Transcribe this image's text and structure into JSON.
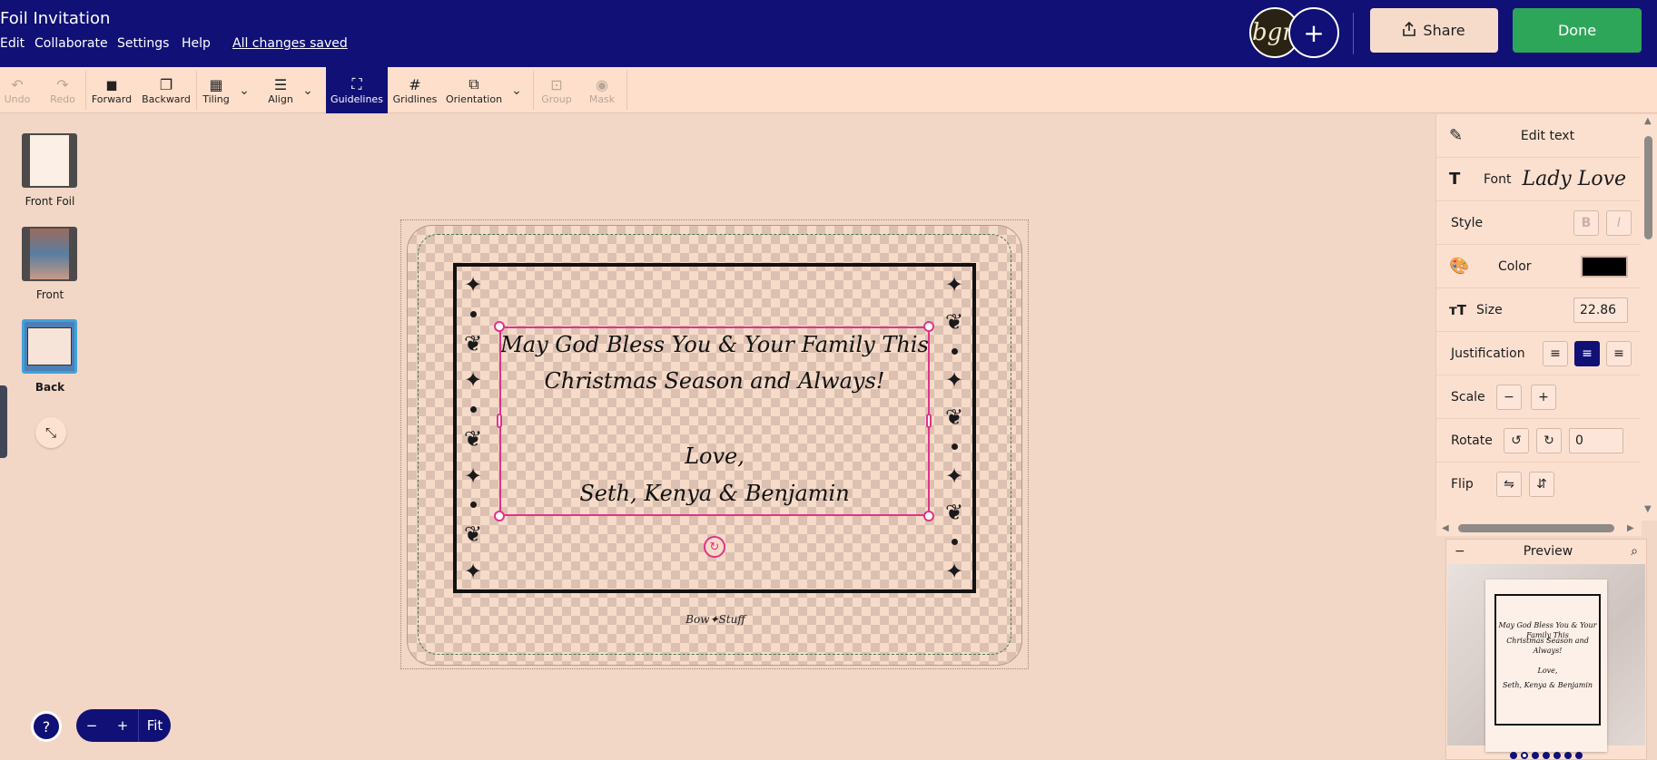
{
  "header": {
    "title": "Foil Invitation",
    "menu": [
      "Edit",
      "Collaborate",
      "Settings",
      "Help"
    ],
    "save_status": "All changes saved",
    "avatar_initials": "bgn",
    "add_collaborator": "+",
    "share_label": "Share",
    "done_label": "Done"
  },
  "toolbar": {
    "undo": "Undo",
    "redo": "Redo",
    "forward": "Forward",
    "backward": "Backward",
    "tiling": "Tiling",
    "align": "Align",
    "guidelines": "Guidelines",
    "gridlines": "Gridlines",
    "orientation": "Orientation",
    "group": "Group",
    "mask": "Mask"
  },
  "pages": {
    "front_foil": "Front Foil",
    "front": "Front",
    "back": "Back",
    "active": "Back"
  },
  "canvas": {
    "line1": "May God Bless You & Your Family This",
    "line2": "Christmas Season and Always!",
    "line3": "Love,",
    "line4": "Seth, Kenya & Benjamin",
    "brand": "Bow✦Stuff"
  },
  "zoom": {
    "help": "?",
    "minus": "−",
    "plus": "+",
    "fit": "Fit"
  },
  "properties": {
    "edit_text": "Edit text",
    "font_label": "Font",
    "font_value": "Lady Love",
    "style_label": "Style",
    "bold": "B",
    "italic": "I",
    "color_label": "Color",
    "color_value": "#000000",
    "size_label": "Size",
    "size_value": "22.86",
    "justification_label": "Justification",
    "justification_active": "center",
    "scale_label": "Scale",
    "scale_minus": "−",
    "scale_plus": "+",
    "rotate_label": "Rotate",
    "rotate_value": "0",
    "flip_label": "Flip"
  },
  "preview": {
    "title": "Preview",
    "collapse": "−",
    "page_dots": 7,
    "active_dot": 2
  },
  "colors": {
    "header_bg": "#101076",
    "done_green": "#2ea65a",
    "selection_pink": "#e0338a",
    "toolbar_bg": "#fddfcb"
  }
}
